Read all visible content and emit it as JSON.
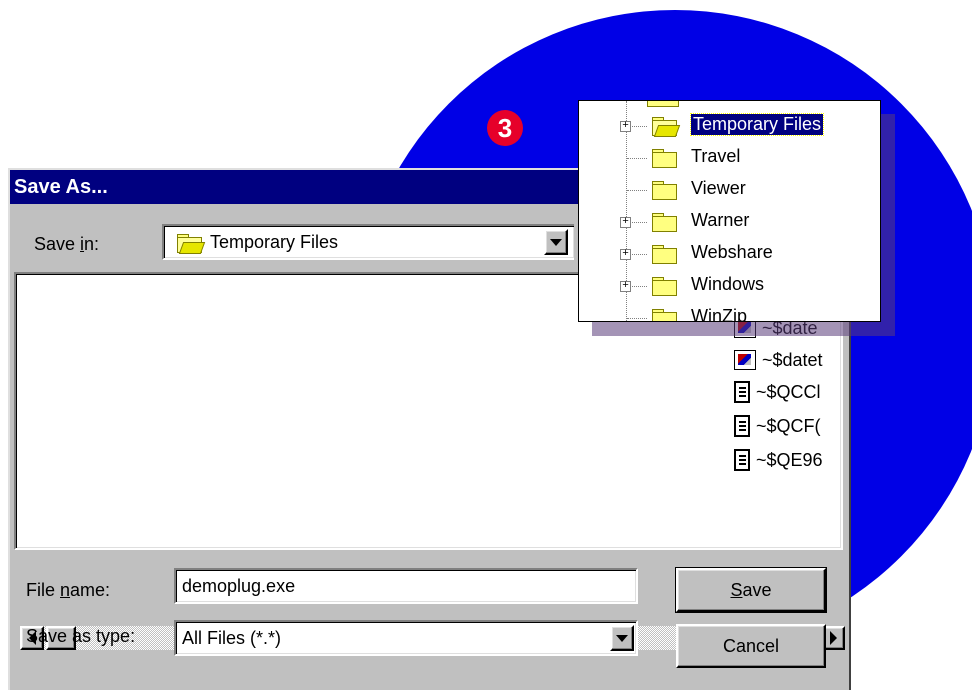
{
  "step_badge": "3",
  "dialog": {
    "title": "Save As...",
    "save_in_label_pre": "Save ",
    "save_in_label_mnemonic": "i",
    "save_in_label_post": "n:",
    "save_in_value": "Temporary Files",
    "file_name_label_pre": "File ",
    "file_name_label_mnemonic": "n",
    "file_name_label_post": "ame:",
    "file_name_value": "demoplug.exe",
    "save_as_type_label": "Save as type:",
    "save_as_type_value": "All Files (*.*)",
    "save_button_mnemonic": "S",
    "save_button_rest": "ave",
    "cancel_button": "Cancel"
  },
  "files": [
    {
      "name": "~$date",
      "icon": "image-doc-icon"
    },
    {
      "name": "~$datet",
      "icon": "image-doc-icon"
    },
    {
      "name": "~$QCCl",
      "icon": "text-doc-icon"
    },
    {
      "name": "~$QCF(",
      "icon": "text-doc-icon"
    },
    {
      "name": "~$QE96",
      "icon": "text-doc-icon"
    }
  ],
  "tree": {
    "items": [
      {
        "label": "Temporary Files",
        "expandable": true,
        "selected": true
      },
      {
        "label": "Travel",
        "expandable": false
      },
      {
        "label": "Viewer",
        "expandable": false
      },
      {
        "label": "Warner",
        "expandable": true
      },
      {
        "label": "Webshare",
        "expandable": true
      },
      {
        "label": "Windows",
        "expandable": true
      },
      {
        "label": "WinZip",
        "expandable": false
      }
    ]
  },
  "colors": {
    "circle": "#0000e6",
    "badge": "#e6002a",
    "titlebar": "#000080",
    "dialog_bg": "#c0c0c0"
  }
}
